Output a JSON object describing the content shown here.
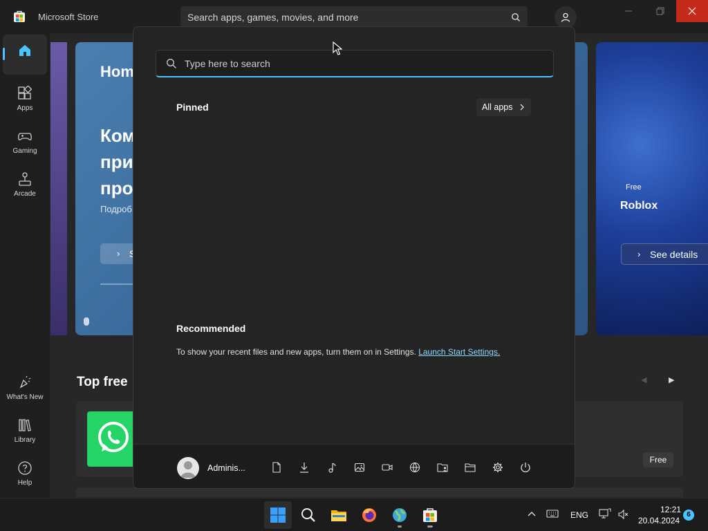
{
  "store": {
    "title": "Microsoft Store",
    "search_placeholder": "Search apps, games, movies, and more",
    "sidebar": [
      {
        "label": "",
        "icon": "home-icon"
      },
      {
        "label": "Apps",
        "icon": "apps-icon"
      },
      {
        "label": "Gaming",
        "icon": "gamepad-icon"
      },
      {
        "label": "Arcade",
        "icon": "joystick-icon"
      },
      {
        "label": "What's New",
        "icon": "sparkle-icon"
      },
      {
        "label": "Library",
        "icon": "library-icon"
      },
      {
        "label": "Help",
        "icon": "help-icon"
      }
    ],
    "hero": {
      "title": "Hom",
      "line1": "Ком",
      "line2": "при",
      "line3": "про",
      "subtitle": "Подроб",
      "button_label": "S"
    },
    "side_hero": {
      "badge": "Free",
      "title": "Roblox",
      "button_label": "See details"
    },
    "section_title": "Top free",
    "free_badge": "Free"
  },
  "start_menu": {
    "search_placeholder": "Type here to search",
    "pinned_title": "Pinned",
    "all_apps_label": "All apps",
    "recommended_title": "Recommended",
    "recommended_text": "To show your recent files and new apps, turn them on in Settings.",
    "recommended_link": "Launch Start Settings.",
    "user_name": "Adminis...",
    "footer_icons": [
      "documents-icon",
      "downloads-icon",
      "music-icon",
      "pictures-icon",
      "videos-icon",
      "network-icon",
      "personal-folder-icon",
      "file-explorer-icon",
      "settings-icon",
      "power-icon"
    ]
  },
  "taskbar": {
    "apps": [
      "start-icon",
      "search-icon",
      "file-explorer-icon",
      "firefox-icon",
      "globe-app-icon",
      "store-icon"
    ],
    "language": "ENG",
    "time": "12:21",
    "date": "20.04.2024",
    "notification_count": "6"
  },
  "colors": {
    "accent": "#4cc2ff",
    "close_button": "#c42b1c",
    "whatsapp": "#25d366",
    "link": "#8fd8ff"
  }
}
